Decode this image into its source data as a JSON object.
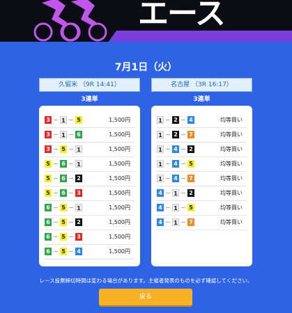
{
  "header": {
    "title": "エース"
  },
  "date": "7月1日（火）",
  "colors": {
    "bg": "#2f63e6",
    "stripe": "#7b3fe0",
    "button": "#f7b226"
  },
  "left": {
    "venue": "久留米 （9R 14:41）",
    "bet_type": "3連単",
    "rows": [
      {
        "a": "3",
        "b": "1",
        "c": "5",
        "amount": "1,500円"
      },
      {
        "a": "3",
        "b": "1",
        "c": "6",
        "amount": "1,500円"
      },
      {
        "a": "3",
        "b": "5",
        "c": "1",
        "amount": "1,500円"
      },
      {
        "a": "5",
        "b": "6",
        "c": "1",
        "amount": "1,500円"
      },
      {
        "a": "5",
        "b": "6",
        "c": "2",
        "amount": "1,500円"
      },
      {
        "a": "5",
        "b": "6",
        "c": "3",
        "amount": "1,500円"
      },
      {
        "a": "6",
        "b": "5",
        "c": "1",
        "amount": "1,500円"
      },
      {
        "a": "6",
        "b": "5",
        "c": "2",
        "amount": "1,500円"
      },
      {
        "a": "6",
        "b": "5",
        "c": "3",
        "amount": "1,500円"
      },
      {
        "a": "6",
        "b": "5",
        "c": "4",
        "amount": "1,500円"
      }
    ]
  },
  "right": {
    "venue": "名古屋 （3R 16:17）",
    "bet_type": "3連単",
    "rows": [
      {
        "a": "1",
        "b": "2",
        "c": "4",
        "amount": "均等買い"
      },
      {
        "a": "1",
        "b": "2",
        "c": "7",
        "amount": "均等買い"
      },
      {
        "a": "1",
        "b": "4",
        "c": "2",
        "amount": "均等買い"
      },
      {
        "a": "1",
        "b": "4",
        "c": "5",
        "amount": "均等買い"
      },
      {
        "a": "1",
        "b": "4",
        "c": "7",
        "amount": "均等買い"
      },
      {
        "a": "4",
        "b": "1",
        "c": "2",
        "amount": "均等買い"
      },
      {
        "a": "4",
        "b": "1",
        "c": "5",
        "amount": "均等買い"
      },
      {
        "a": "4",
        "b": "1",
        "c": "7",
        "amount": "均等買い"
      }
    ]
  },
  "note": "レース投票締切時間は変わる場合があります。主催者発表のものを必ず確認してください。",
  "back_label": "戻る"
}
